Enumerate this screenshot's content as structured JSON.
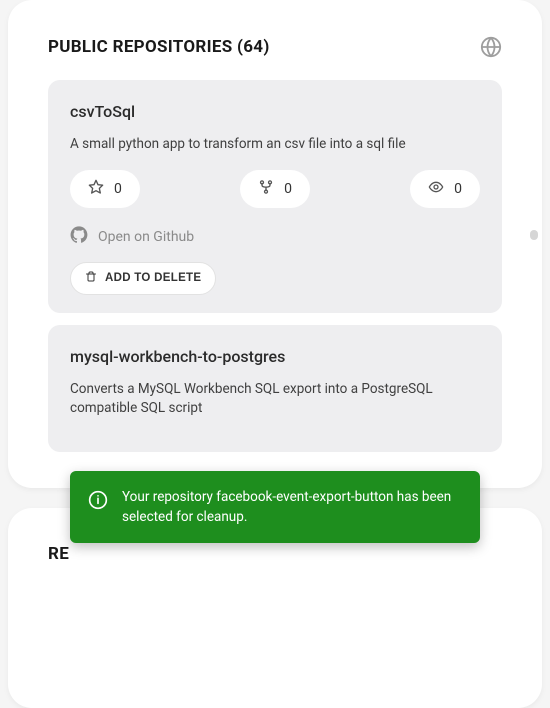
{
  "header": {
    "title": "PUBLIC REPOSITORIES (64)"
  },
  "repos": [
    {
      "name": "csvToSql",
      "description": "A small python app to transform an csv file into a sql file",
      "stars": "0",
      "forks": "0",
      "watchers": "0",
      "open_label": "Open on Github",
      "add_label": "ADD TO DELETE"
    },
    {
      "name": "mysql-workbench-to-postgres",
      "description": "Converts a MySQL Workbench SQL export into a PostgreSQL compatible SQL script"
    }
  ],
  "second_section": {
    "title_prefix": "RE"
  },
  "toast": {
    "message": "Your repository facebook-event-export-button has been selected for cleanup."
  }
}
